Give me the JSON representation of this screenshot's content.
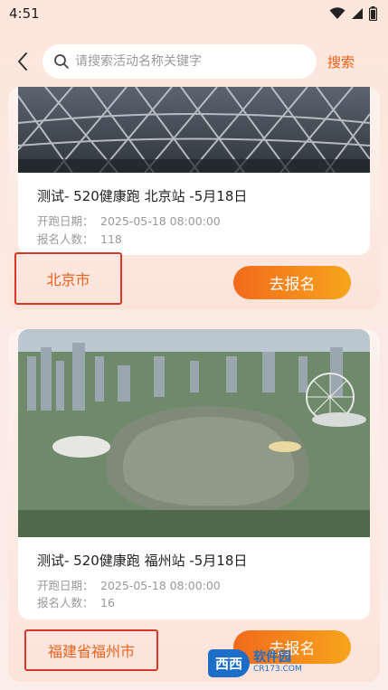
{
  "status_bar": {
    "time": "4:51",
    "icons": [
      "wifi-icon",
      "signal-icon",
      "battery-icon"
    ]
  },
  "search": {
    "placeholder": "请搜索活动名称关键字",
    "button_label": "搜索"
  },
  "events": [
    {
      "title": "测试- 520健康跑 北京站 -5月18日",
      "date_label": "开跑日期：",
      "date_value": "2025-05-18 08:00:00",
      "count_label": "报名人数：",
      "count_value": "118",
      "city": "北京市",
      "signup_label": "去报名"
    },
    {
      "title": "测试- 520健康跑 福州站 -5月18日",
      "date_label": "开跑日期：",
      "date_value": "2025-05-18 08:00:00",
      "count_label": "报名人数：",
      "count_value": "16",
      "city": "福建省福州市",
      "signup_label": "去报名"
    }
  ],
  "watermark": {
    "badge": "西西",
    "name": "软件园",
    "url": "CR173.COM"
  },
  "colors": {
    "accent": "#f05d12",
    "button_gradient_start": "#f26a1b",
    "button_gradient_end": "#f7a51b",
    "highlight_border": "#d9362a"
  }
}
